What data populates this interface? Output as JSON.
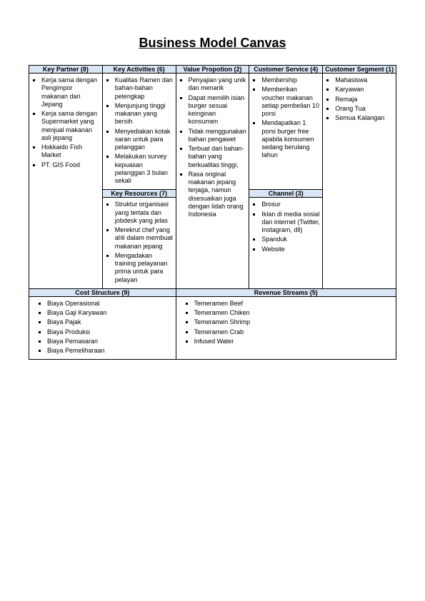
{
  "title": "Business Model Canvas",
  "columns": {
    "key_partner": {
      "header": "Key Partner (8)",
      "items": [
        "Kerja sama dengan Pengimpor makanan dari Jepang",
        "Kerja sama dengan Supermarket yang menjual makanan asli jepang",
        "Hokkaido Fish Market",
        "PT. GIS Food"
      ]
    },
    "key_activities": {
      "header": "Key Activities (6)",
      "items": [
        "Kualitas Ramen dan bahan-bahan pelengkap",
        "Menjunjung tinggi makanan yang bersih",
        "Menyediakan kotak saran untuk para pelanggan",
        "Melakukan survey kepuasan pelanggan 3 bulan sekali"
      ]
    },
    "key_resources": {
      "header": "Key Resources (7)",
      "items": [
        "Struktur organisasi yang tertata dan jobdesk yang jelas",
        "Merekrut chef yang ahli dalam membuat makanan jepang",
        "Mengadakan training pelayanan prima untuk para pelayan"
      ]
    },
    "value_proposition": {
      "header": "Value Propotion (2)",
      "items": [
        "Penyajian yang unik dan menarik",
        "Dapat memilih isian burger sesuai keinginan konsumen",
        "Tidak menggunakan bahan pengawet",
        "Terbuat dari bahan-bahan yang berkualitas tinggi,",
        "Rasa original makanan jepang terjaga, namun disesuaikan juga dengan lidah orang Indonesia"
      ]
    },
    "customer_service": {
      "header": "Customer Service (4)",
      "items": [
        "Membership",
        "Memberikan voucher makanan setiap pembelian 10 porsi",
        "Mendapatkan 1 porsi burger free apabila konsumen sedang berulang tahun"
      ]
    },
    "channel": {
      "header": "Channel (3)",
      "items": [
        "Brosur",
        "Iklan di media sosial dan internet (Twitter, Instagram, dll)",
        "Spanduk",
        "Website"
      ]
    },
    "customer_segment": {
      "header": "Customer Segment (1)",
      "items": [
        "Mahasiswa",
        "Karyawan",
        "Remaja",
        "Orang Tua",
        "Semua Kalangan"
      ]
    },
    "cost_structure": {
      "header": "Cost Structure (9)",
      "items": [
        "Biaya Operasional",
        "Biaya Gaji Karyawan",
        "Biaya Pajak",
        "Biaya Produksi",
        "Biaya Pemasaran",
        "Biaya Pemeliharaan"
      ]
    },
    "revenue_streams": {
      "header": "Revenue Streams (5)",
      "items": [
        "Temeramen Beef",
        "Temeramen Chiken",
        "Temeramen Shrimp",
        "Temeramen Crab",
        "Infused Water"
      ]
    }
  }
}
